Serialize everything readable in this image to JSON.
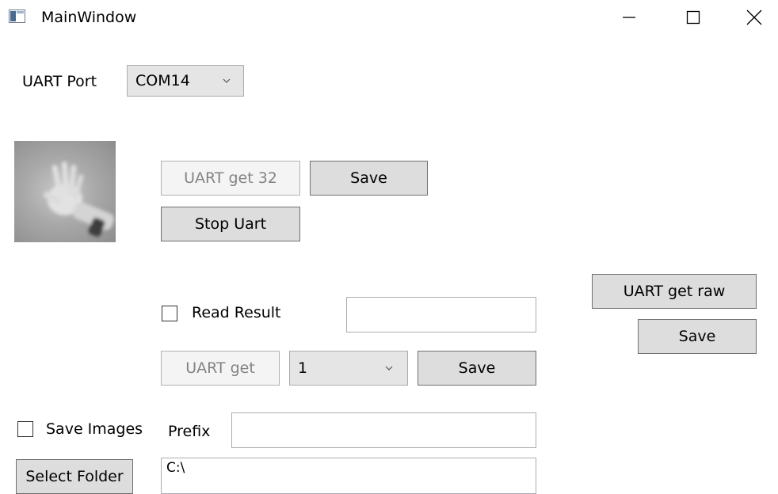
{
  "window": {
    "title": "MainWindow"
  },
  "uart_port": {
    "label": "UART Port",
    "selected": "COM14"
  },
  "buttons": {
    "uart_get_32": "UART get 32",
    "save_32": "Save",
    "stop_uart": "Stop Uart",
    "uart_get_raw": "UART get raw",
    "save_raw": "Save",
    "uart_get": "UART get",
    "save_get": "Save",
    "select_folder": "Select Folder"
  },
  "read_result": {
    "label": "Read Result",
    "checked": false,
    "value": ""
  },
  "uart_get_count": {
    "selected": "1"
  },
  "save_images": {
    "label": "Save Images",
    "checked": false
  },
  "prefix": {
    "label": "Prefix",
    "value": ""
  },
  "folder_path": {
    "value": "C:\\"
  },
  "icons": {
    "app": "window-app-icon",
    "minimize": "minimize-icon",
    "maximize": "maximize-icon",
    "close": "close-icon"
  }
}
